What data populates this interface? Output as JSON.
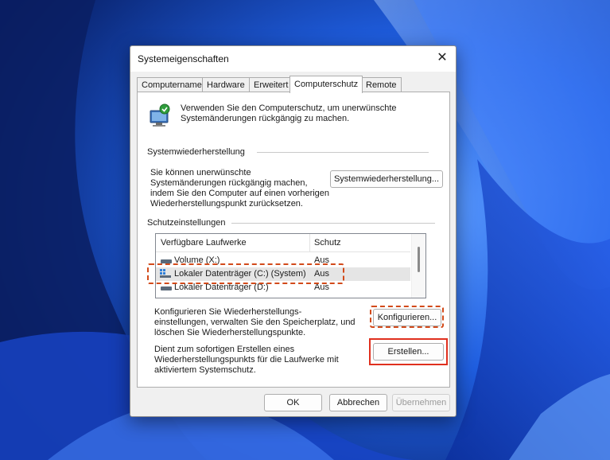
{
  "dialog": {
    "title": "Systemeigenschaften",
    "close_glyph": "✕"
  },
  "tabs": [
    "Computername",
    "Hardware",
    "Erweitert",
    "Computerschutz",
    "Remote"
  ],
  "active_tab": "Computerschutz",
  "intro": {
    "line1": "Verwenden Sie den Computerschutz, um unerwünschte",
    "line2": "Systemänderungen rückgängig zu machen.",
    "icon": "system-protection-icon"
  },
  "restore": {
    "heading": "Systemwiederherstellung",
    "desc": [
      "Sie können unerwünschte",
      "Systemänderungen rückgängig machen,",
      "indem Sie den Computer auf einen vorherigen",
      "Wiederherstellungspunkt zurücksetzen."
    ],
    "button": "Systemwiederherstellung..."
  },
  "protection": {
    "heading": "Schutzeinstellungen",
    "columns": [
      "Verfügbare Laufwerke",
      "Schutz"
    ],
    "rows": [
      {
        "drive": "Volume (X:)",
        "status": "Aus",
        "icon": "drive-icon"
      },
      {
        "drive": "Lokaler Datenträger (C:) (System)",
        "status": "Aus",
        "icon": "windows-drive-icon"
      },
      {
        "drive": "Lokaler Datenträger (D:)",
        "status": "Aus",
        "icon": "drive-icon"
      }
    ],
    "selected_row": 1
  },
  "configure": {
    "desc": [
      "Konfigurieren Sie Wiederherstellungs-",
      "einstellungen, verwalten Sie den Speicherplatz, und",
      "löschen Sie Wiederherstellungspunkte."
    ],
    "button": "Konfigurieren..."
  },
  "create": {
    "desc": [
      "Dient zum sofortigen Erstellen eines",
      "Wiederherstellungspunkts für die Laufwerke mit",
      "aktiviertem Systemschutz."
    ],
    "button": "Erstellen..."
  },
  "footer": {
    "ok": "OK",
    "cancel": "Abbrechen",
    "apply": "Übernehmen"
  },
  "colors": {
    "annotation_dashed": "#d24a1a",
    "annotation_solid": "#e0301e",
    "wallpaper_dark": "#0a2a8a",
    "wallpaper_light": "#4f8dff"
  }
}
